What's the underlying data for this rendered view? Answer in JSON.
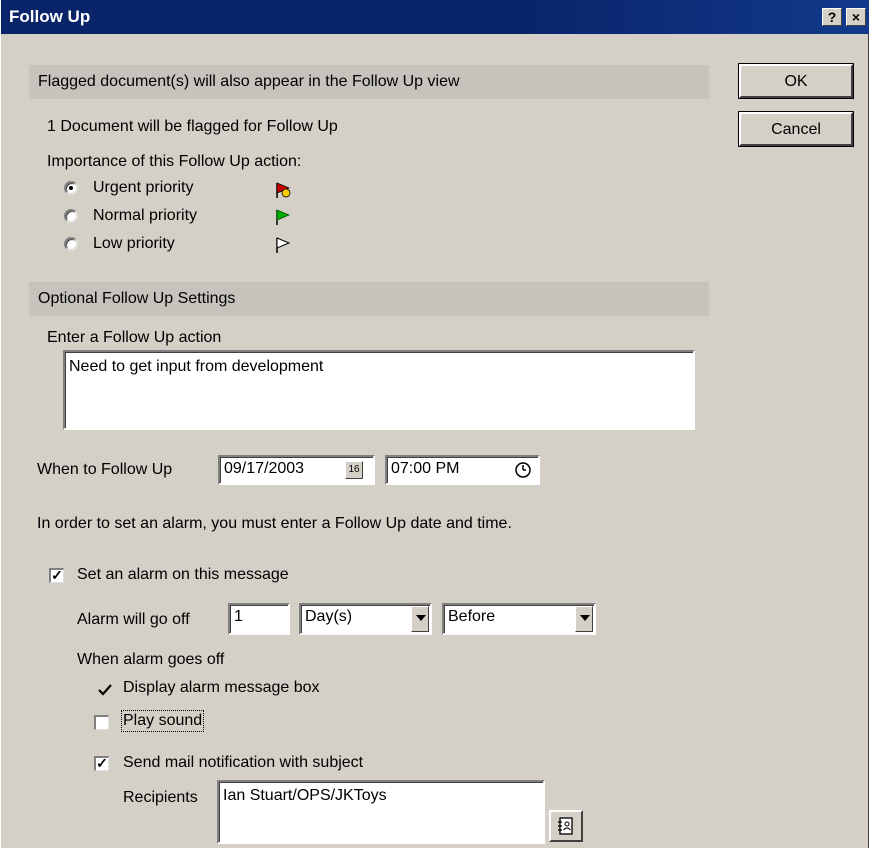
{
  "window": {
    "title": "Follow Up",
    "help_label": "?",
    "close_label": "×"
  },
  "header": {
    "banner": "Flagged document(s) will also appear in the Follow Up view",
    "doc_count": "1 Document will be flagged for Follow Up",
    "importance_label": "Importance of this Follow Up action:"
  },
  "priorities": [
    {
      "label": "Urgent priority",
      "selected": true,
      "flag_color": "#cc0000",
      "icon": "urgent-flag-icon"
    },
    {
      "label": "Normal priority",
      "selected": false,
      "flag_color": "#00aa00",
      "icon": "normal-flag-icon"
    },
    {
      "label": "Low priority",
      "selected": false,
      "flag_color": "#ffffff",
      "icon": "low-flag-icon"
    }
  ],
  "buttons": {
    "ok": "OK",
    "cancel": "Cancel"
  },
  "optional": {
    "section_title": "Optional Follow Up Settings",
    "action_label": "Enter a Follow Up action",
    "action_value": "Need to get input from development",
    "when_label": "When to Follow Up",
    "date_value": "09/17/2003",
    "calendar_icon_text": "16",
    "time_value": "07:00 PM",
    "alarm_note": "In order to set an alarm, you must enter a Follow Up date and time."
  },
  "alarm": {
    "set_alarm_label": "Set an alarm on this message",
    "set_alarm_checked": true,
    "go_off_label": "Alarm will go off",
    "go_off_value": "1",
    "unit_value": "Day(s)",
    "relation_value": "Before",
    "when_goes_off_label": "When alarm goes off",
    "display_box_label": "Display alarm message box",
    "play_sound_label": "Play sound",
    "play_sound_checked": false,
    "send_mail_label": "Send mail notification with subject",
    "send_mail_checked": true,
    "recipients_label": "Recipients",
    "recipients_value": "Ian Stuart/OPS/JKToys"
  },
  "colors": {
    "window_bg": "#d4d0c8",
    "titlebar": "#0a246a",
    "section_band": "#c6c3bc"
  }
}
